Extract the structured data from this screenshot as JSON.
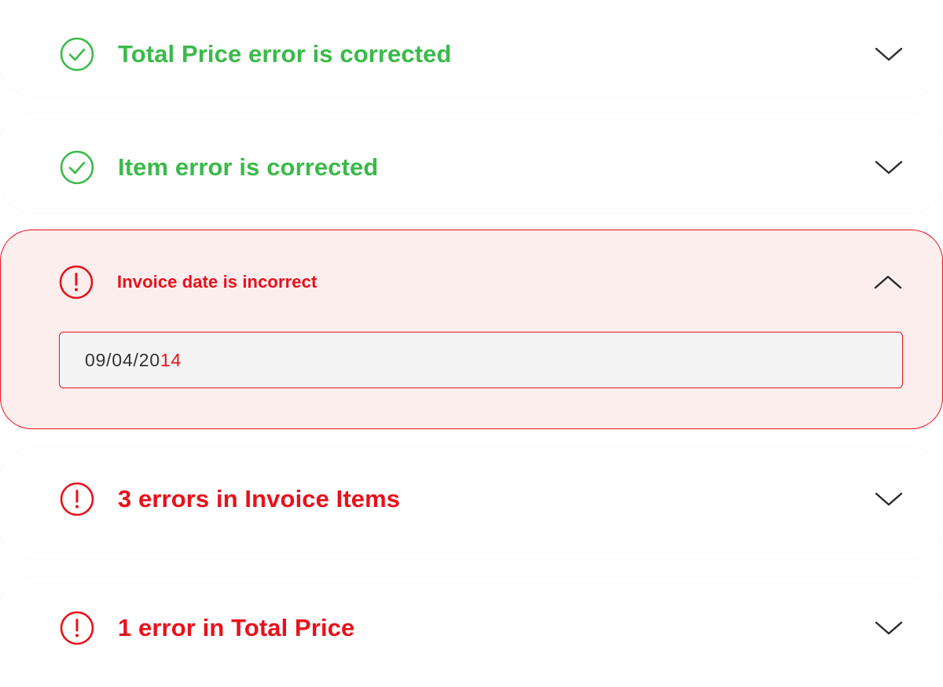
{
  "colors": {
    "success": "#3aba4a",
    "error": "#e8111b",
    "error_bg": "#fdeeee",
    "chevron": "#2b2b2b"
  },
  "items": [
    {
      "status": "success",
      "icon": "check-circle-icon",
      "title": "Total Price error is corrected",
      "expanded": false
    },
    {
      "status": "success",
      "icon": "check-circle-icon",
      "title": "Item error is corrected",
      "expanded": false
    },
    {
      "status": "error",
      "icon": "exclamation-circle-icon",
      "title": "Invoice date is incorrect",
      "expanded": true,
      "field": {
        "value_prefix": "09/04/20",
        "value_error": "14"
      }
    },
    {
      "status": "error",
      "icon": "exclamation-circle-icon",
      "title": "3 errors in Invoice Items",
      "expanded": false
    },
    {
      "status": "error",
      "icon": "exclamation-circle-icon",
      "title": "1 error in Total Price",
      "expanded": false
    }
  ]
}
